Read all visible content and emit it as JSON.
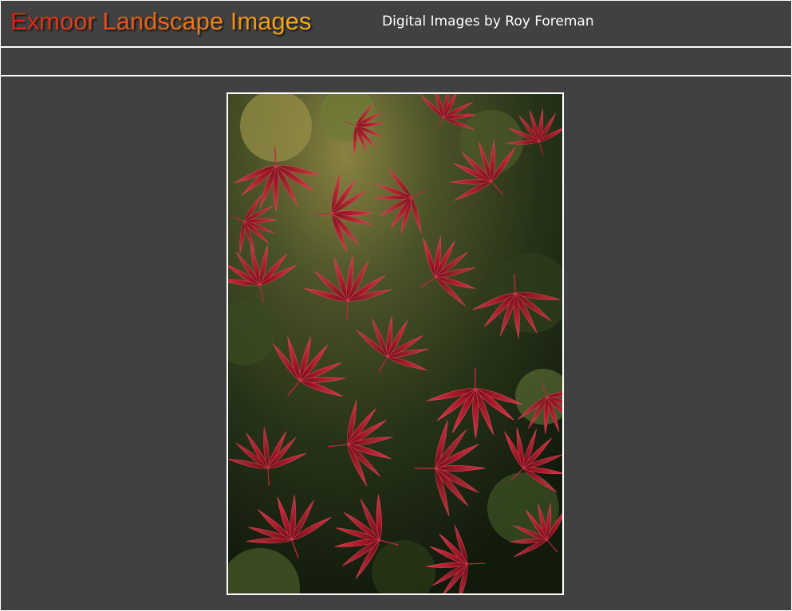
{
  "header": {
    "logo_text": "Exmoor Landscape Images",
    "tagline": "Digital Images by Roy Foreman"
  },
  "colors": {
    "page_background": "#414141",
    "rule_color": "#ffffff",
    "logo_gradient_start": "#d81f14",
    "logo_gradient_end": "#f7b316",
    "leaf_red": "#b3182c",
    "leaf_highlight": "#e04255",
    "foliage_dark": "#1f2a14"
  },
  "photo": {
    "subject": "red-maple-leaves-photo"
  }
}
